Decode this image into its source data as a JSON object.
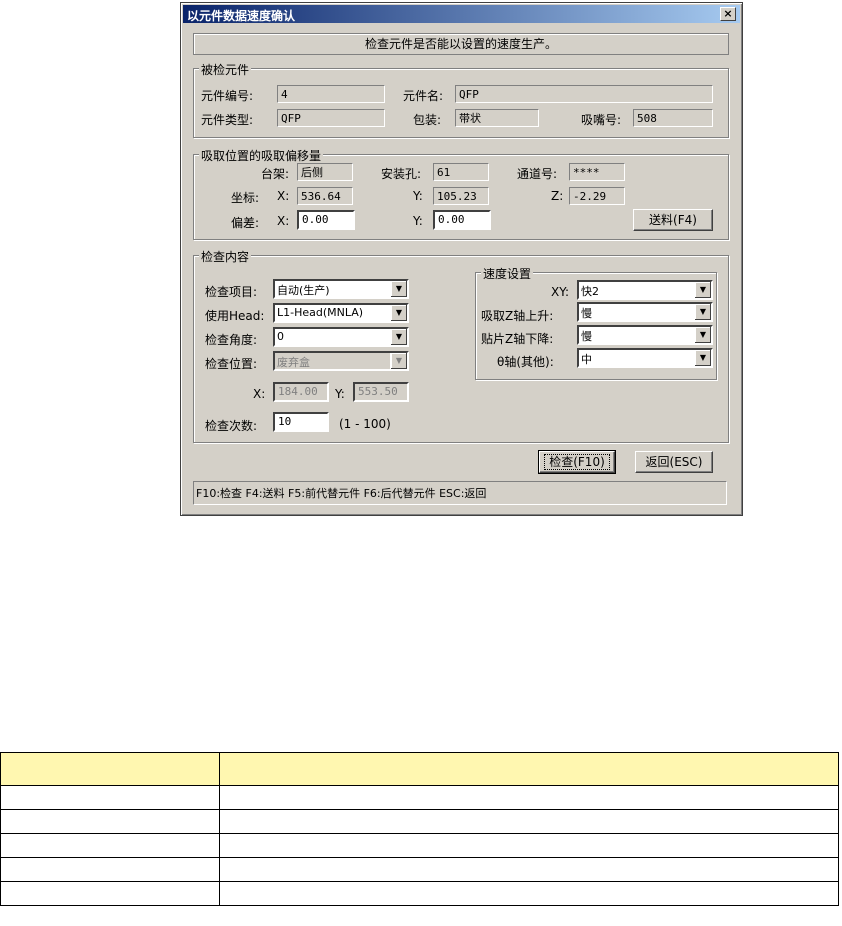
{
  "dialog": {
    "title": "以元件数据速度确认",
    "close_glyph": "×",
    "banner": "检查元件是否能以设置的速度生产。"
  },
  "component_group": {
    "legend": "被检元件",
    "number_label": "元件编号:",
    "number_value": "4",
    "name_label": "元件名:",
    "name_value": "QFP",
    "type_label": "元件类型:",
    "type_value": "QFP",
    "package_label": "包装:",
    "package_value": "带状",
    "nozzle_label": "吸嘴号:",
    "nozzle_value": "508"
  },
  "pickup_group": {
    "legend": "吸取位置的吸取偏移量",
    "stage_label": "台架:",
    "stage_value": "后侧",
    "hole_label": "安装孔:",
    "hole_value": "61",
    "lane_label": "通道号:",
    "lane_value": "****",
    "coord_label": "坐标:",
    "x_label": "X:",
    "coord_x": "536.64",
    "y_label": "Y:",
    "coord_y": "105.23",
    "z_label": "Z:",
    "coord_z": "-2.29",
    "offset_label": "偏差:",
    "offset_x": "0.00",
    "offset_y": "0.00",
    "feed_button": "送料(F4)"
  },
  "inspect_group": {
    "legend": "检查内容",
    "item_label": "检查项目:",
    "item_value": "自动(生产)",
    "head_label": "使用Head:",
    "head_value": "L1-Head(MNLA)",
    "angle_label": "检查角度:",
    "angle_value": "0",
    "position_label": "检查位置:",
    "position_value": "废弃盒",
    "pos_x_label": "X:",
    "pos_x_value": "184.00",
    "pos_y_label": "Y:",
    "pos_y_value": "553.50",
    "count_label": "检查次数:",
    "count_value": "10",
    "count_range": "(1 - 100)"
  },
  "speed_group": {
    "legend": "速度设置",
    "xy_label": "XY:",
    "xy_value": "快2",
    "pick_z_label": "吸取Z轴上升:",
    "pick_z_value": "慢",
    "place_z_label": "贴片Z轴下降:",
    "place_z_value": "慢",
    "theta_label": "θ轴(其他):",
    "theta_value": "中"
  },
  "buttons": {
    "check": "检查(F10)",
    "back": "返回(ESC)"
  },
  "statusbar": {
    "text": "F10:检查   F4:送料   F5:前代替元件   F6:后代替元件   ESC:返回"
  },
  "colors": {
    "dialog_bg": "#d4d0c8",
    "titlebar_start": "#0a246a",
    "titlebar_end": "#a6caf0",
    "table_header_bg": "#fff7b0"
  }
}
